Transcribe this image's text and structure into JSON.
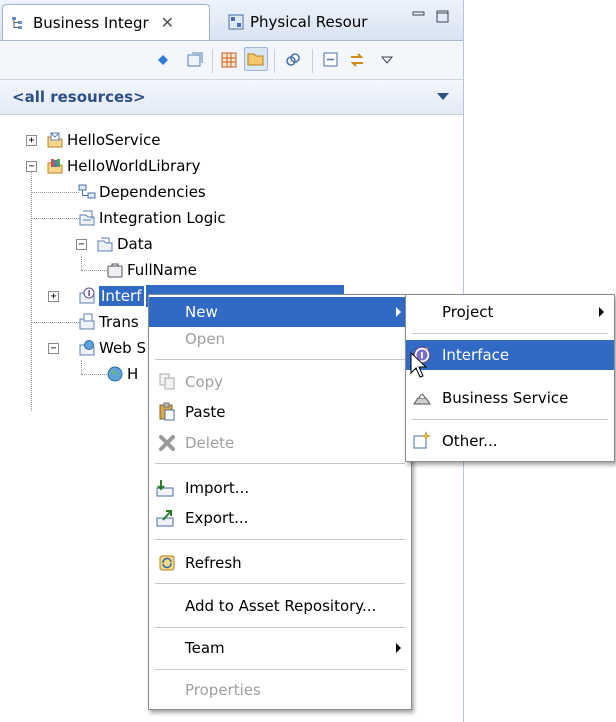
{
  "tabs": [
    {
      "label": "Business Integr",
      "close": "✕"
    },
    {
      "label": "Physical Resour"
    }
  ],
  "filter": {
    "label": "<all resources>"
  },
  "tree": {
    "hello_service": "HelloService",
    "hello_world_library": "HelloWorldLibrary",
    "dependencies": "Dependencies",
    "integration_logic": "Integration Logic",
    "data": "Data",
    "full_name": "FullName",
    "interfaces": "Interf",
    "transformations": "Trans",
    "web_services": "Web S",
    "web_child": "H"
  },
  "context_menu": {
    "new": "New",
    "open": "Open",
    "copy": "Copy",
    "paste": "Paste",
    "delete": "Delete",
    "import": "Import...",
    "export": "Export...",
    "refresh": "Refresh",
    "add_to_asset_repository": "Add to Asset Repository...",
    "team": "Team",
    "properties": "Properties"
  },
  "submenu": {
    "project": "Project",
    "interface": "Interface",
    "business_service": "Business Service",
    "other": "Other..."
  },
  "colors": {
    "selection": "#316ac5",
    "filter_text": "#2c4f87"
  }
}
